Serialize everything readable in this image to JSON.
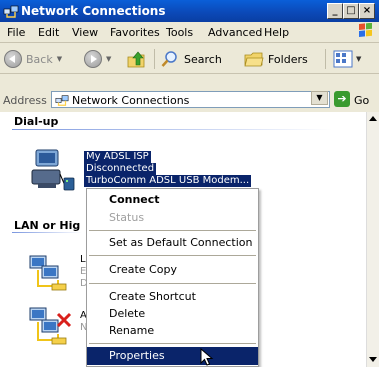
{
  "window": {
    "title": "Network Connections"
  },
  "menubar": {
    "items": [
      "File",
      "Edit",
      "View",
      "Favorites",
      "Tools",
      "Advanced",
      "Help"
    ]
  },
  "toolbar": {
    "back_label": "Back",
    "search_label": "Search",
    "folders_label": "Folders"
  },
  "address": {
    "label": "Address",
    "value": "Network Connections",
    "go_label": "Go"
  },
  "groups": {
    "dialup": "Dial-up",
    "lan": "LAN or Hig"
  },
  "connection": {
    "name": "My ADSL ISP",
    "status": "Disconnected",
    "device": "TurboComm ADSL USB Modem..."
  },
  "lan_items": [
    {
      "frag1": "L",
      "frag2": "E",
      "frag3": "D"
    },
    {
      "frag1": "A",
      "frag2": "N"
    }
  ],
  "context_menu": {
    "connect": "Connect",
    "status": "Status",
    "set_default": "Set as Default Connection",
    "create_copy": "Create Copy",
    "create_shortcut": "Create Shortcut",
    "delete": "Delete",
    "rename": "Rename",
    "properties": "Properties"
  },
  "colors": {
    "titlebar": "#0b48b6",
    "selection": "#0a246a",
    "menu_highlight": "#0a246a"
  }
}
